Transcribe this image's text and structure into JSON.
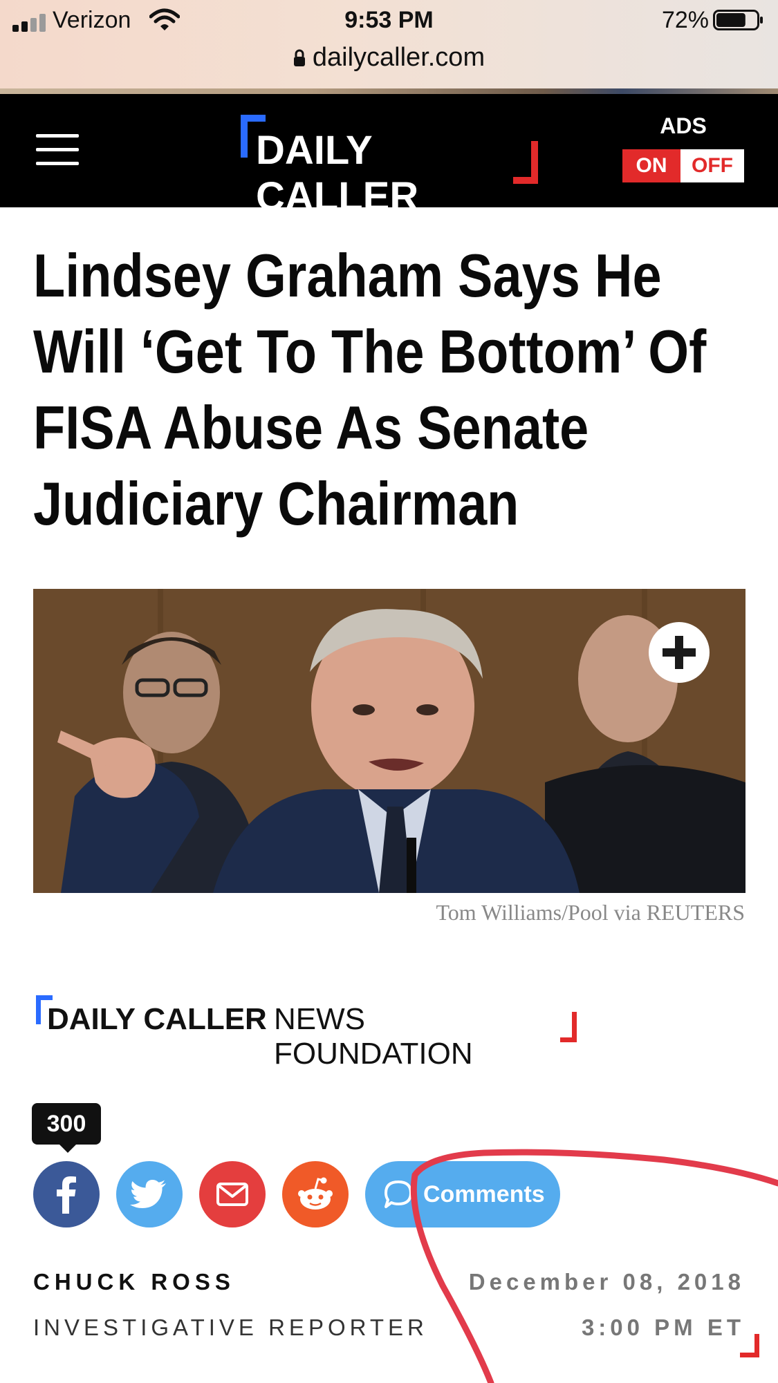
{
  "status_bar": {
    "carrier": "Verizon",
    "time": "9:53 PM",
    "battery": "72%",
    "battery_level": 0.72,
    "signal_bars": 2,
    "url": "dailycaller.com"
  },
  "header": {
    "logo_text": "DAILY CALLER",
    "ads_label": "ADS",
    "ads_on": "ON",
    "ads_off": "OFF"
  },
  "article": {
    "headline": "Lindsey Graham Says He Will ‘Get To The Bottom’ Of FISA Abuse As Senate Judiciary Chairman",
    "photo_credit": "Tom Williams/Pool via REUTERS",
    "foundation_bold": "DAILY CALLER",
    "foundation_light": "NEWS FOUNDATION"
  },
  "share": {
    "count": "300",
    "comments_label": "Comments"
  },
  "byline": {
    "author": "CHUCK ROSS",
    "role": "INVESTIGATIVE REPORTER",
    "date": "December 08, 2018",
    "time": "3:00 PM ET"
  },
  "colors": {
    "blue_bracket": "#2a6bff",
    "red_bracket": "#e22a2a",
    "facebook": "#3b5998",
    "twitter": "#55acee",
    "email": "#e43e3e",
    "reddit": "#f05a28",
    "annotation": "#e23b4b"
  }
}
